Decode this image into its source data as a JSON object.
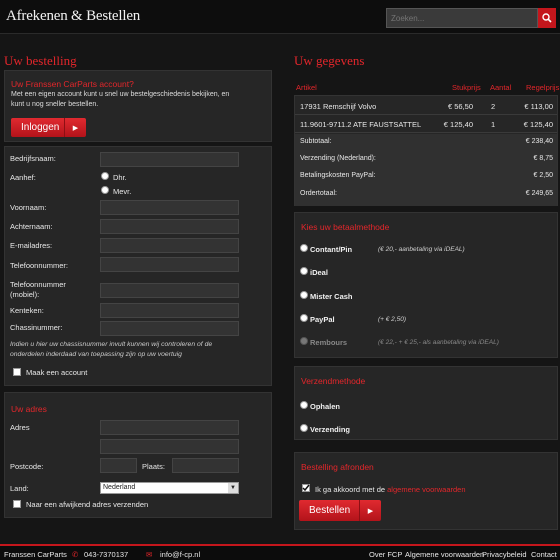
{
  "header": {
    "title": "Afrekenen & Bestellen",
    "search_placeholder": "Zoeken..."
  },
  "left": {
    "heading": "Uw bestelling",
    "account": {
      "title": "Uw Franssen CarParts account?",
      "text_line1": "Met een eigen account kunt u snel uw bestelgeschiedenis bekijken, en",
      "text_line2": "kunt u nog sneller bestellen.",
      "login_label": "Inloggen"
    },
    "form": {
      "company": "Bedrijfsnaam:",
      "salutation": "Aanhef:",
      "sir": "Dhr.",
      "madam": "Mevr.",
      "firstname": "Voornaam:",
      "lastname": "Achternaam:",
      "email": "E-mailadres:",
      "phone": "Telefoonnummer:",
      "mobile_line1": "Telefoonnummer",
      "mobile_line2": "(mobiel):",
      "plate": "Kenteken:",
      "chassis": "Chassinummer:",
      "note_line1": "Indien u hier uw chassisnummer invult kunnen wij controleren of de",
      "note_line2": "onderdelen inderdaad van toepassing zijn op uw voertuig",
      "create_account": "Maak een account"
    },
    "address": {
      "title": "Uw adres",
      "adres": "Adres",
      "postcode": "Postcode:",
      "city": "Plaats:",
      "country": "Land:",
      "country_value": "Nederland",
      "alt_address": "Naar een afwijkend adres verzenden"
    }
  },
  "right": {
    "heading": "Uw gegevens",
    "table": {
      "headers": [
        "Artikel",
        "Stukprijs",
        "Aantal",
        "Regelprijs"
      ],
      "rows": [
        {
          "article": "17931 Remschijf Volvo",
          "price": "€ 56,50",
          "qty": "2",
          "total": "€ 113,00"
        },
        {
          "article": "11.9601-9711.2 ATE FAUSTSATTEL",
          "price": "€ 125,40",
          "qty": "1",
          "total": "€ 125,40"
        }
      ],
      "summary": [
        {
          "label": "Subtotaal:",
          "value": "€ 238,40"
        },
        {
          "label": "Verzending (Nederland):",
          "value": "€ 8,75"
        },
        {
          "label": "Betalingskosten PayPal:",
          "value": "€ 2,50"
        },
        {
          "label": "Ordertotaal:",
          "value": "€ 249,65"
        }
      ]
    },
    "payment": {
      "title": "Kies uw betaalmethode",
      "options": [
        {
          "label": "Contant/Pin",
          "note": "(€ 20,- aanbetaling via iDEAL)"
        },
        {
          "label": "iDeal",
          "note": ""
        },
        {
          "label": "Mister Cash",
          "note": ""
        },
        {
          "label": "PayPal",
          "note": "(+ € 2,50)"
        },
        {
          "label": "Rembours",
          "note": "(€ 22,- + € 25,- als aanbetaling via iDEAL)"
        }
      ]
    },
    "shipping": {
      "title": "Verzendmethode",
      "options": [
        "Ophalen",
        "Verzending"
      ]
    },
    "finish": {
      "title": "Bestelling afronden",
      "agree_prefix": "Ik ga akkoord met de",
      "agree_link": "algemene voorwaarden",
      "order_label": "Bestellen"
    }
  },
  "footer": {
    "brand": "Franssen CarParts",
    "phone": "043-7370137",
    "email": "info@f-cp.nl",
    "links": [
      "Over FCP",
      "Algemene voorwaarden",
      "Privacybeleid",
      "Contact"
    ]
  },
  "colors": {
    "accent": "#e3262b",
    "panel": "#262626",
    "background": "#151515"
  }
}
